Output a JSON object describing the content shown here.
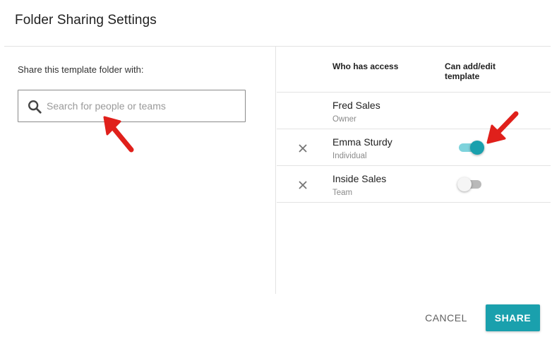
{
  "dialog": {
    "title": "Folder Sharing Settings"
  },
  "left_panel": {
    "share_label": "Share this template folder with:",
    "search": {
      "placeholder": "Search for people or teams",
      "value": ""
    }
  },
  "access_table": {
    "headers": {
      "who": "Who has access",
      "can_edit": "Can add/edit template"
    },
    "rows": [
      {
        "name": "Fred Sales",
        "role": "Owner",
        "removable": false,
        "can_edit": null
      },
      {
        "name": "Emma Sturdy",
        "role": "Individual",
        "removable": true,
        "can_edit": true
      },
      {
        "name": "Inside Sales",
        "role": "Team",
        "removable": true,
        "can_edit": false
      }
    ]
  },
  "footer": {
    "cancel_label": "CANCEL",
    "share_label": "SHARE"
  },
  "colors": {
    "accent": "#1aa0ad",
    "accent_light": "#7ed3dc",
    "annotation_arrow": "#e0201b"
  },
  "icons": {
    "search": "search-icon",
    "remove": "close-icon",
    "annotation": "red-arrow-icon"
  }
}
